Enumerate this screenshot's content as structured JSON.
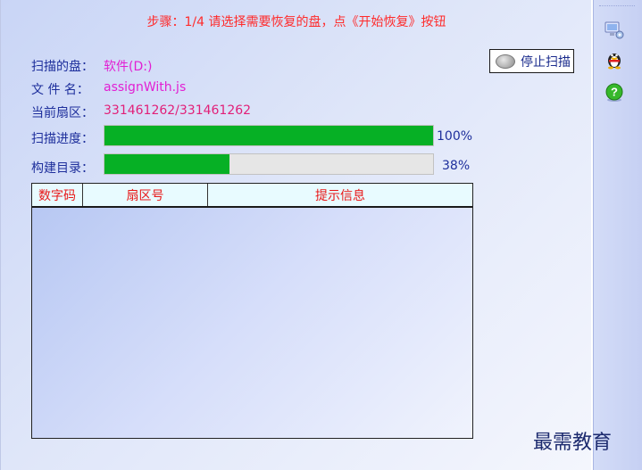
{
  "header": {
    "step_text": "步骤：1/4 请选择需要恢复的盘，点《开始恢复》按钮"
  },
  "info": {
    "disk_label": "扫描的盘：",
    "disk_value": "软件(D:)",
    "file_label": "文 件 名：",
    "file_value": "assignWith.js",
    "sector_label": "当前扇区：",
    "sector_value": "331461262/331461262"
  },
  "progress": {
    "scan_label": "扫描进度：",
    "scan_percent": 100,
    "scan_percent_text": "100%",
    "build_label": "构建目录：",
    "build_percent": 38,
    "build_percent_text": "38%"
  },
  "table": {
    "columns": [
      "数字码",
      "扇区号",
      "提示信息"
    ],
    "rows": []
  },
  "actions": {
    "stop_scan_label": "停止扫描"
  },
  "toolbar": {
    "icons": [
      "computer-settings-icon",
      "qq-penguin-icon",
      "help-icon"
    ]
  },
  "watermark": {
    "text": "最需教育"
  },
  "colors": {
    "progress_fill": "#06b025",
    "step_text": "#ff2b2b",
    "label_blue": "#1e2f9c",
    "value_magenta": "#e21fd3",
    "column_header_text": "#e81818"
  }
}
